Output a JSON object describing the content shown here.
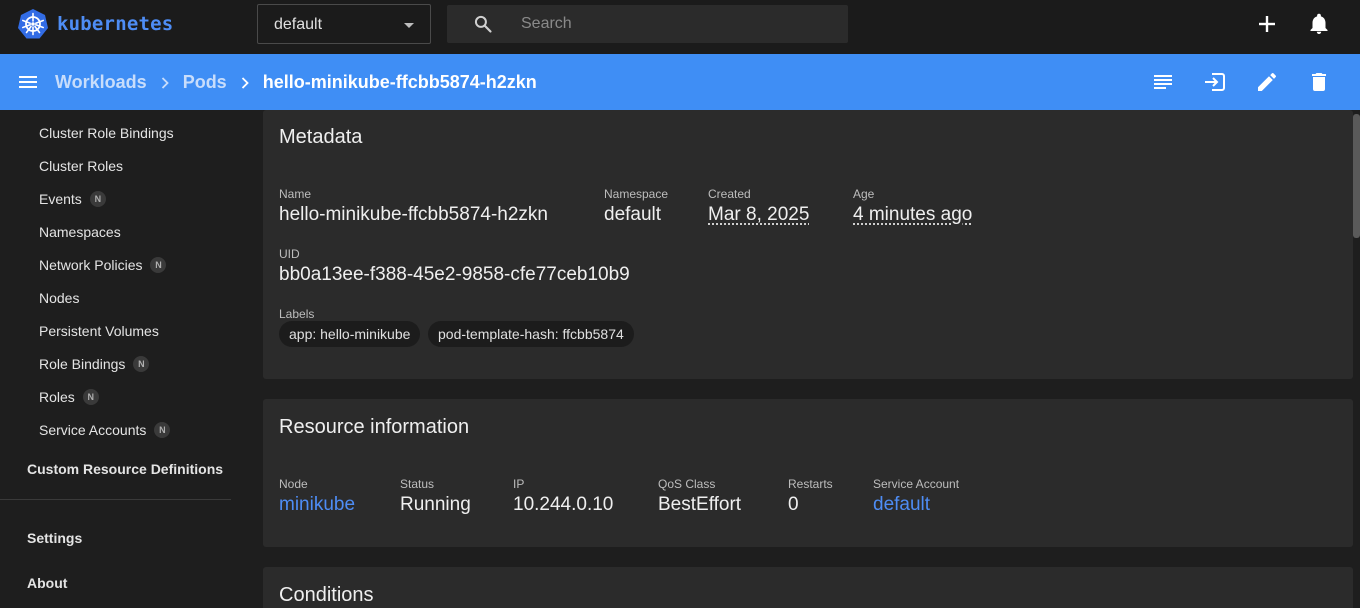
{
  "topbar": {
    "brand": "kubernetes",
    "namespace_selected": "default",
    "search_placeholder": "Search"
  },
  "header": {
    "breadcrumbs": [
      "Workloads",
      "Pods"
    ],
    "current": "hello-minikube-ffcbb5874-h2zkn"
  },
  "sidebar": {
    "items": [
      {
        "label": "Cluster Role Bindings",
        "badge": ""
      },
      {
        "label": "Cluster Roles",
        "badge": ""
      },
      {
        "label": "Events",
        "badge": "N"
      },
      {
        "label": "Namespaces",
        "badge": ""
      },
      {
        "label": "Network Policies",
        "badge": "N"
      },
      {
        "label": "Nodes",
        "badge": ""
      },
      {
        "label": "Persistent Volumes",
        "badge": ""
      },
      {
        "label": "Role Bindings",
        "badge": "N"
      },
      {
        "label": "Roles",
        "badge": "N"
      },
      {
        "label": "Service Accounts",
        "badge": "N"
      }
    ],
    "crd": "Custom Resource Definitions",
    "settings": "Settings",
    "about": "About"
  },
  "metadata": {
    "title": "Metadata",
    "name_label": "Name",
    "name": "hello-minikube-ffcbb5874-h2zkn",
    "namespace_label": "Namespace",
    "namespace": "default",
    "created_label": "Created",
    "created": "Mar 8, 2025",
    "age_label": "Age",
    "age": "4 minutes ago",
    "uid_label": "UID",
    "uid": "bb0a13ee-f388-45e2-9858-cfe77ceb10b9",
    "labels_label": "Labels",
    "labels": [
      "app: hello-minikube",
      "pod-template-hash: ffcbb5874"
    ]
  },
  "resource": {
    "title": "Resource information",
    "node_label": "Node",
    "node": "minikube",
    "status_label": "Status",
    "status": "Running",
    "ip_label": "IP",
    "ip": "10.244.0.10",
    "qos_label": "QoS Class",
    "qos": "BestEffort",
    "restarts_label": "Restarts",
    "restarts": "0",
    "sa_label": "Service Account",
    "sa": "default"
  },
  "conditions": {
    "title": "Conditions"
  },
  "colors": {
    "accent": "#3f8ef5",
    "link": "#4e8df5",
    "card": "#2b2b2b",
    "background": "#1e1e1e"
  }
}
